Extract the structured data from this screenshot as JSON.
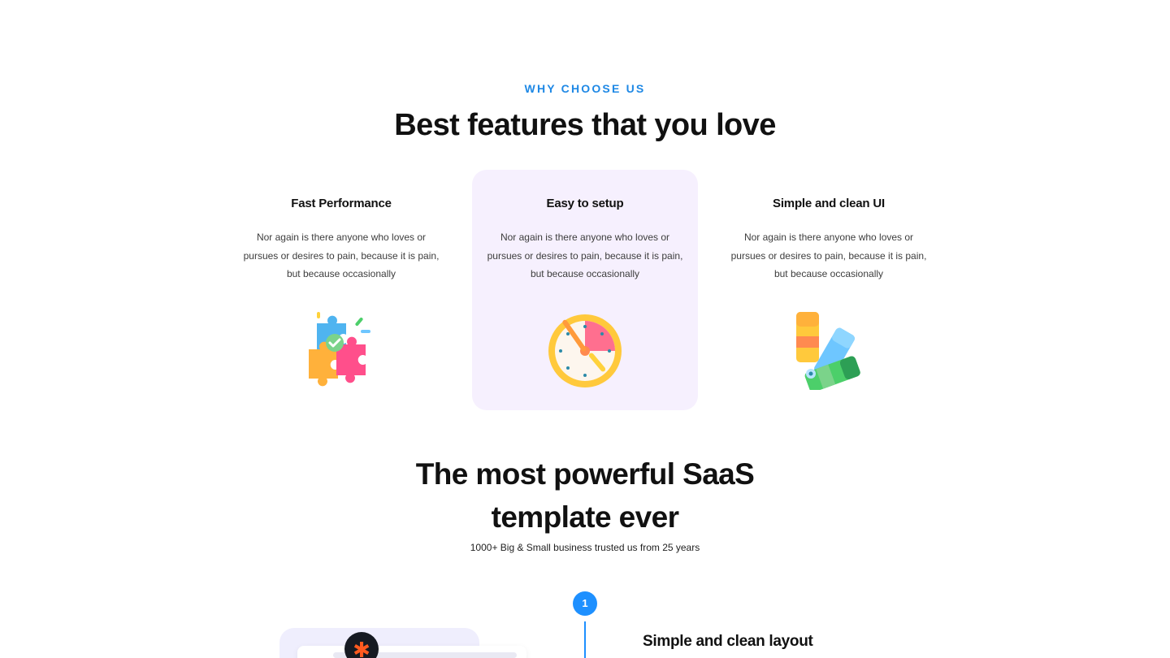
{
  "section": {
    "eyebrow": "WHY CHOOSE US",
    "headline": "Best features that you love"
  },
  "features": [
    {
      "title": "Fast Performance",
      "description": "Nor again is there anyone who loves or pursues or desires to pain, because it is pain, but because occasionally",
      "icon": "puzzle-icon"
    },
    {
      "title": "Easy to setup",
      "description": "Nor again is there anyone who loves or pursues or desires to pain, because it is pain, but because occasionally",
      "icon": "clock-icon",
      "highlighted": true
    },
    {
      "title": "Simple and clean UI",
      "description": "Nor again is there anyone who loves or pursues or desires to pain, because it is pain, but because occasionally",
      "icon": "color-swatch-icon"
    }
  ],
  "saas": {
    "title_line1": "The most powerful SaaS",
    "title_line2": "template ever",
    "subtitle": "1000+ Big & Small business trusted us from 25 years"
  },
  "steps": [
    {
      "number": "1",
      "title": "Simple and clean layout"
    }
  ],
  "mockup": {
    "avatar_glyph": "✱"
  },
  "colors": {
    "accent": "#1e88e5",
    "highlight_card": "#f6f0fe",
    "step_badge": "#1e90ff"
  }
}
